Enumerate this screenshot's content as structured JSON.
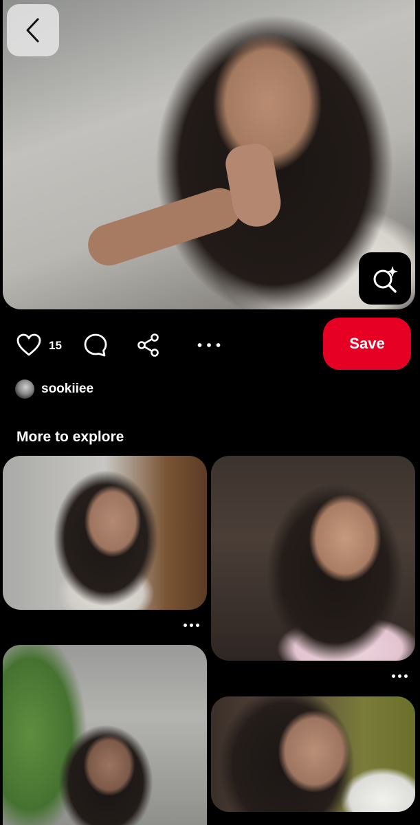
{
  "pin": {
    "like_count": "15",
    "save_label": "Save"
  },
  "creator": {
    "name": "sookiiee"
  },
  "explore": {
    "title": "More to explore"
  },
  "icons": {
    "back": "chevron-left-icon",
    "visual_search": "visual-search-icon",
    "like": "heart-icon",
    "comment": "comment-icon",
    "share": "share-icon",
    "more": "more-icon"
  },
  "colors": {
    "background": "#000000",
    "save_button": "#e60023",
    "text": "#ffffff"
  }
}
